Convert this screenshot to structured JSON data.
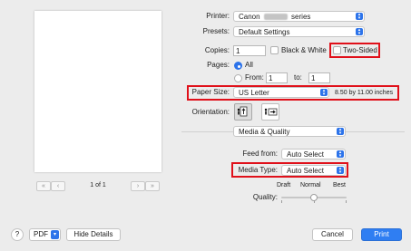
{
  "preview": {
    "page_indicator": "1 of 1",
    "first_glyph": "«",
    "prev_glyph": "‹",
    "next_glyph": "›",
    "last_glyph": "»"
  },
  "printer": {
    "label": "Printer:",
    "name_prefix": "Canon",
    "name_suffix": "series"
  },
  "presets": {
    "label": "Presets:",
    "value": "Default Settings"
  },
  "copies": {
    "label": "Copies:",
    "value": "1",
    "bw_label": "Black & White",
    "two_sided_label": "Two-Sided"
  },
  "pages": {
    "label": "Pages:",
    "all_label": "All",
    "from_label": "From:",
    "from_value": "1",
    "to_label": "to:",
    "to_value": "1"
  },
  "paper_size": {
    "label": "Paper Size:",
    "value": "US Letter",
    "dimensions": "8.50 by 11.00 inches"
  },
  "orientation": {
    "label": "Orientation:"
  },
  "panel": {
    "value": "Media & Quality"
  },
  "feed": {
    "label": "Feed from:",
    "value": "Auto Select"
  },
  "media_type": {
    "label": "Media Type:",
    "value": "Auto Select"
  },
  "quality": {
    "label": "Quality:",
    "draft": "Draft",
    "normal": "Normal",
    "best": "Best",
    "level": 0.5
  },
  "footer": {
    "help": "?",
    "pdf": "PDF",
    "hide_details": "Hide Details",
    "cancel": "Cancel",
    "print": "Print"
  },
  "colors": {
    "accent": "#2c73ea",
    "highlight_red": "#e0101a",
    "window_bg": "#ececec"
  }
}
